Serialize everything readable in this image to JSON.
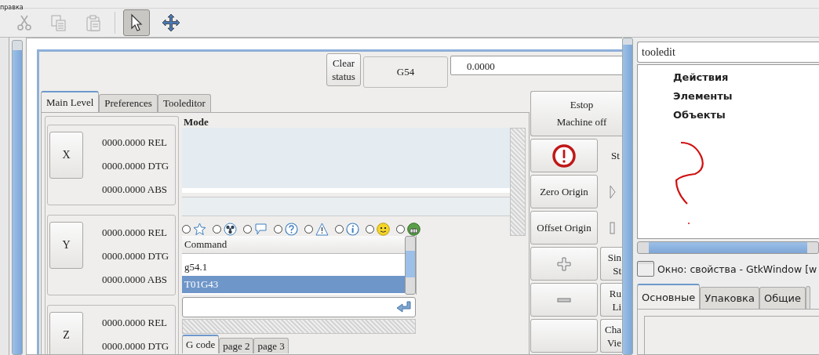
{
  "menubar": {
    "label": "правка"
  },
  "toolbar": [
    {
      "kind": "cut",
      "disabled": true,
      "selected": false
    },
    {
      "kind": "copy",
      "disabled": true,
      "selected": false
    },
    {
      "kind": "paste",
      "disabled": true,
      "selected": false
    },
    {
      "kind": "pointer",
      "disabled": false,
      "selected": true
    },
    {
      "kind": "move",
      "disabled": false,
      "selected": false
    }
  ],
  "designer_window": {
    "clear_button": "Clear status",
    "offset_label": "G54",
    "value_field": "0.0000",
    "tabs": [
      {
        "label": "Main Level",
        "selected": true
      },
      {
        "label": "Preferences",
        "selected": false
      },
      {
        "label": "Tooleditor",
        "selected": false
      }
    ],
    "axes": [
      {
        "name": "X",
        "readouts": [
          "0000.0000 REL",
          "0000.0000 DTG",
          "0000.0000 ABS"
        ]
      },
      {
        "name": "Y",
        "readouts": [
          "0000.0000 REL",
          "0000.0000 DTG",
          "0000.0000 ABS"
        ]
      },
      {
        "name": "Z",
        "readouts": [
          "0000.0000 REL",
          "0000.0000 DTG"
        ]
      }
    ],
    "mode_label": "Mode",
    "message_icons": [
      {
        "kind": "star",
        "selected": false
      },
      {
        "kind": "radiation",
        "selected": false
      },
      {
        "kind": "speech",
        "selected": false
      },
      {
        "kind": "question",
        "selected": false
      },
      {
        "kind": "warning",
        "selected": false
      },
      {
        "kind": "info",
        "selected": false
      },
      {
        "kind": "smiley",
        "selected": false
      },
      {
        "kind": "grin",
        "selected": false
      }
    ],
    "command_list": {
      "header": "Command",
      "rows": [
        {
          "text": "g54.1",
          "selected": false
        },
        {
          "text": "T01G43",
          "selected": true
        }
      ]
    },
    "bottom_tabs": [
      {
        "label": "G code",
        "selected": true
      },
      {
        "label": "page 2",
        "selected": false
      },
      {
        "label": "page 3",
        "selected": false
      }
    ],
    "estop": {
      "label": "Estop",
      "status": "Machine off"
    },
    "side_buttons": [
      {
        "kind": "alert"
      },
      {
        "kind": "text",
        "label": "Zero Origin"
      },
      {
        "kind": "text",
        "label": "Offset Origin"
      },
      {
        "kind": "plus"
      },
      {
        "kind": "minus"
      },
      {
        "kind": "blank"
      }
    ],
    "side_items": [
      {
        "kind": "label",
        "lines": [
          "St"
        ]
      },
      {
        "kind": "play"
      },
      {
        "kind": "stop"
      },
      {
        "kind": "button",
        "lines": [
          "Sin",
          "St"
        ]
      },
      {
        "kind": "button",
        "lines": [
          "Ru",
          "Li"
        ]
      },
      {
        "kind": "button",
        "lines": [
          "Cha",
          "Vie"
        ]
      }
    ]
  },
  "inspector": {
    "search": "tooledit",
    "tree": [
      "Действия",
      "Элементы",
      "Объекты"
    ],
    "property_title": "Окно: свойства - GtkWindow [w",
    "tabs": [
      {
        "label": "Основные",
        "selected": true
      },
      {
        "label": "Упаковка",
        "selected": false
      },
      {
        "label": "Общие",
        "selected": false
      }
    ]
  }
}
